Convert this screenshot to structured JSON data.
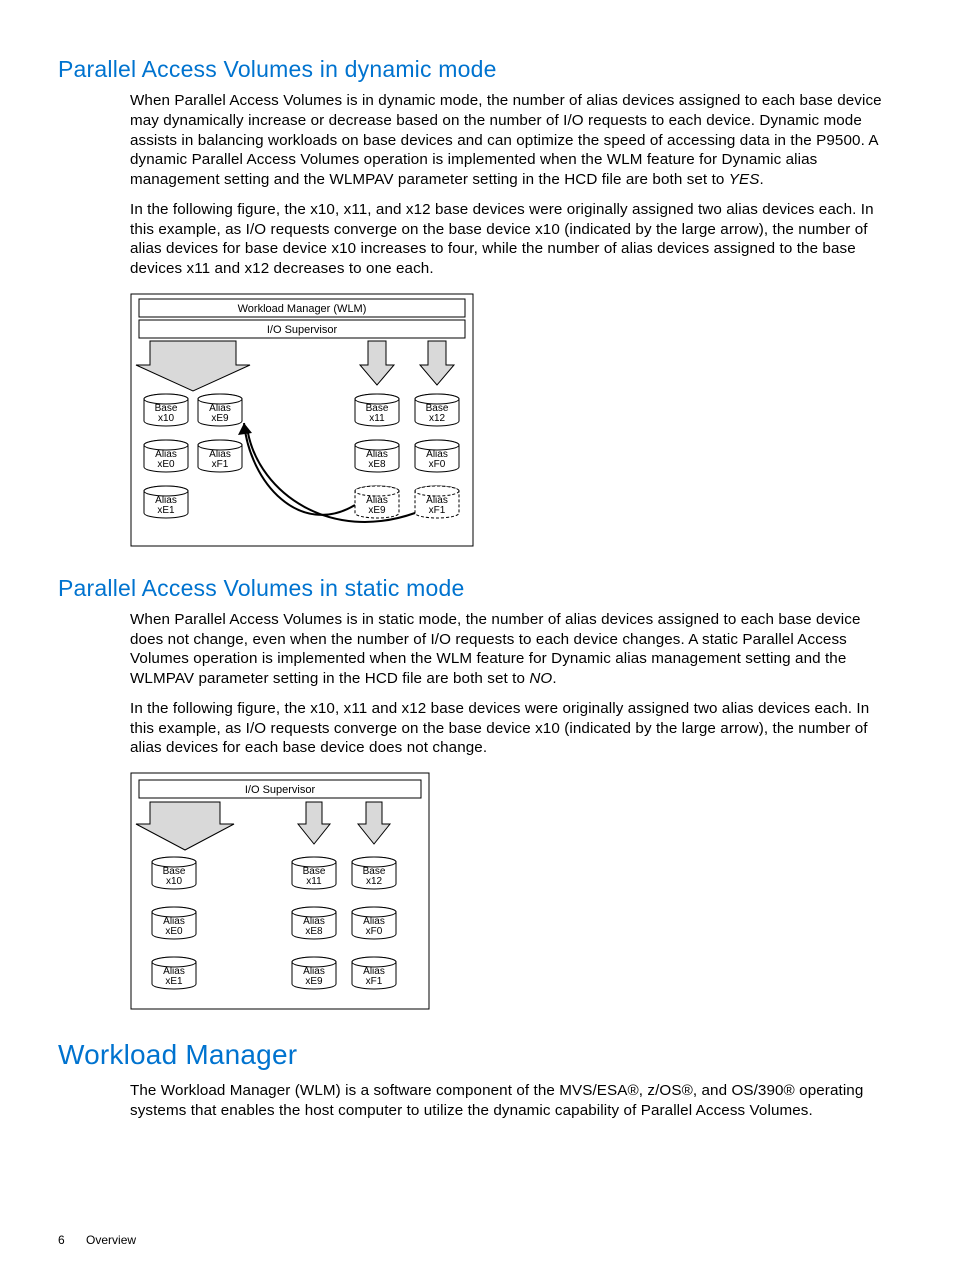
{
  "section1": {
    "heading": "Parallel Access Volumes in dynamic mode",
    "p1a": "When Parallel Access Volumes is in dynamic mode, the number of alias devices assigned to each base device may dynamically increase or decrease based on the number of I/O requests to each device. Dynamic mode assists in balancing workloads on base devices and can optimize the speed of accessing data in the P9500. A dynamic Parallel Access Volumes operation is implemented when the WLM feature for Dynamic alias management setting and the WLMPAV parameter setting in the HCD file are both set to ",
    "p1b": "YES",
    "p1c": ".",
    "p2": "In the following figure, the x10, x11, and x12 base devices were originally assigned two alias devices each. In this example, as I/O requests converge on the base device x10 (indicated by the large arrow), the number of alias devices for base device x10 increases to four, while the number of alias devices assigned to the base devices x11 and x12 decreases to one each."
  },
  "fig1": {
    "wlm": "Workload Manager (WLM)",
    "io": "I/O Supervisor",
    "c11a": "Base",
    "c11b": "x10",
    "c12a": "Alias",
    "c12b": "xE9",
    "c21a": "Alias",
    "c21b": "xE0",
    "c22a": "Alias",
    "c22b": "xF1",
    "c31a": "Alias",
    "c31b": "xE1",
    "r11a": "Base",
    "r11b": "x11",
    "r12a": "Base",
    "r12b": "x12",
    "r21a": "Alias",
    "r21b": "xE8",
    "r22a": "Alias",
    "r22b": "xF0",
    "r31a": "Alias",
    "r31b": "xE9",
    "r32a": "Alias",
    "r32b": "xF1"
  },
  "section2": {
    "heading": "Parallel Access Volumes in static mode",
    "p1a": "When Parallel Access Volumes is in static mode, the number of alias devices assigned to each base device does not change, even when the number of I/O requests to each device changes. A static Parallel Access Volumes operation is implemented when the WLM feature for Dynamic alias management setting and the WLMPAV parameter setting in the HCD file are both set to ",
    "p1b": "NO",
    "p1c": ".",
    "p2": "In the following figure, the x10, x11 and x12 base devices were originally assigned two alias devices each. In this example, as I/O requests converge on the base device x10 (indicated by the large arrow), the number of alias devices for each base device does not change."
  },
  "fig2": {
    "io": "I/O Supervisor",
    "l11a": "Base",
    "l11b": "x10",
    "l21a": "Alias",
    "l21b": "xE0",
    "l31a": "Alias",
    "l31b": "xE1",
    "m11a": "Base",
    "m11b": "x11",
    "m21a": "Alias",
    "m21b": "xE8",
    "m31a": "Alias",
    "m31b": "xE9",
    "r11a": "Base",
    "r11b": "x12",
    "r21a": "Alias",
    "r21b": "xF0",
    "r31a": "Alias",
    "r31b": "xF1"
  },
  "section3": {
    "heading": "Workload Manager",
    "p1": "The Workload Manager (WLM) is a software component of the MVS/ESA®, z/OS®, and OS/390® operating systems that enables the host computer to utilize the dynamic capability of Parallel Access Volumes."
  },
  "footer": {
    "page": "6",
    "section": "Overview"
  }
}
